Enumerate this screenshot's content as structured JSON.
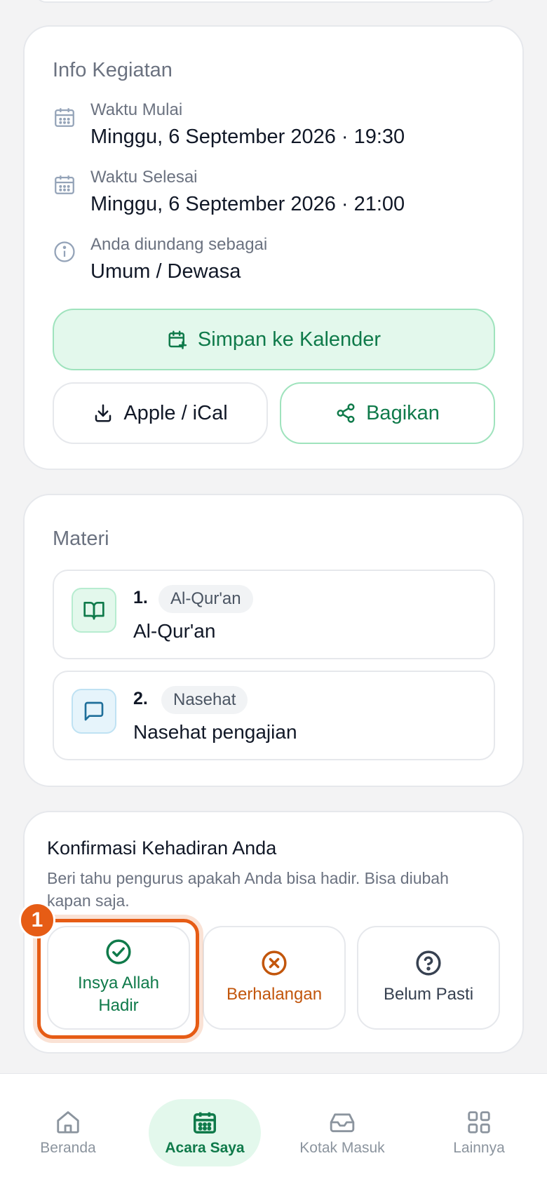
{
  "info": {
    "title": "Info Kegiatan",
    "start_label": "Waktu Mulai",
    "start_value": "Minggu, 6 September 2026 · 19:30",
    "end_label": "Waktu Selesai",
    "end_value": "Minggu, 6 September 2026 · 21:00",
    "invited_label": "Anda diundang sebagai",
    "invited_value": "Umum / Dewasa",
    "save_calendar": "Simpan ke Kalender",
    "ical": "Apple / iCal",
    "share": "Bagikan"
  },
  "materi": {
    "title": "Materi",
    "items": [
      {
        "num": "1.",
        "tag": "Al-Qur'an",
        "title": "Al-Qur'an",
        "icon": "book-open-icon"
      },
      {
        "num": "2.",
        "tag": "Nasehat",
        "title": "Nasehat pengajian",
        "icon": "message-square-icon"
      }
    ]
  },
  "rsvp": {
    "title": "Konfirmasi Kehadiran Anda",
    "subtitle": "Beri tahu pengurus apakah Anda bisa hadir. Bisa diubah kapan saja.",
    "options": [
      {
        "label": "Insya Allah Hadir",
        "icon": "check-circle-icon",
        "color": "#0f7a4a"
      },
      {
        "label": "Berhalangan",
        "icon": "x-circle-icon",
        "color": "#c2560c"
      },
      {
        "label": "Belum Pasti",
        "icon": "help-circle-icon",
        "color": "#374151"
      }
    ],
    "step_marker": "1"
  },
  "nav": {
    "items": [
      {
        "label": "Beranda",
        "icon": "home-icon"
      },
      {
        "label": "Acara Saya",
        "icon": "calendar-icon",
        "active": true
      },
      {
        "label": "Kotak Masuk",
        "icon": "inbox-icon"
      },
      {
        "label": "Lainnya",
        "icon": "grid-icon"
      }
    ]
  },
  "colors": {
    "accent": "#0f7a4a",
    "accent_bg": "#e3f8ec",
    "warning": "#c2560c",
    "highlight": "#e65c15"
  }
}
